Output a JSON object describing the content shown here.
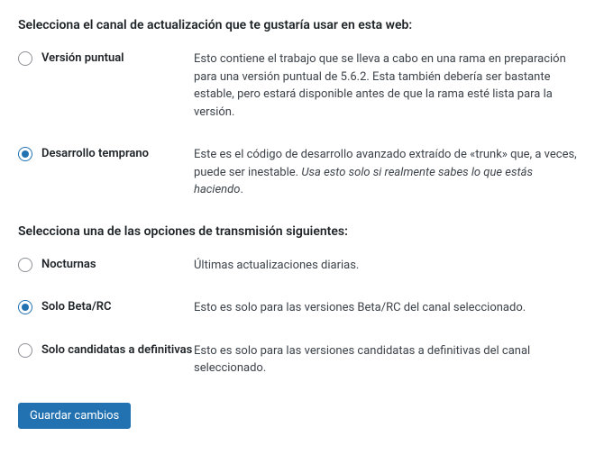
{
  "section1": {
    "heading": "Selecciona el canal de actualización que te gustaría usar en esta web:",
    "options": [
      {
        "label": "Versión puntual",
        "desc": "Esto contiene el trabajo que se lleva a cabo en una rama en preparación para una versión puntual de 5.6.2. Esta también debería ser bastante estable, pero estará disponible antes de que la rama esté lista para la versión.",
        "checked": false
      },
      {
        "label": "Desarrollo temprano",
        "desc_prefix": "Este es el código de desarrollo avanzado extraído de «trunk» que, a veces, puede ser inestable. ",
        "desc_italic": "Usa esto solo si realmente sabes lo que estás haciendo",
        "desc_suffix": ".",
        "checked": true
      }
    ]
  },
  "section2": {
    "heading": "Selecciona una de las opciones de transmisión siguientes:",
    "options": [
      {
        "label": "Nocturnas",
        "desc": "Últimas actualizaciones diarias.",
        "checked": false
      },
      {
        "label": "Solo Beta/RC",
        "desc": "Esto es solo para las versiones Beta/RC del canal seleccionado.",
        "checked": true
      },
      {
        "label": "Solo candidatas a definitivas",
        "desc": "Esto es solo para las versiones candidatas a definitivas del canal seleccionado.",
        "checked": false
      }
    ]
  },
  "save_button": "Guardar cambios"
}
